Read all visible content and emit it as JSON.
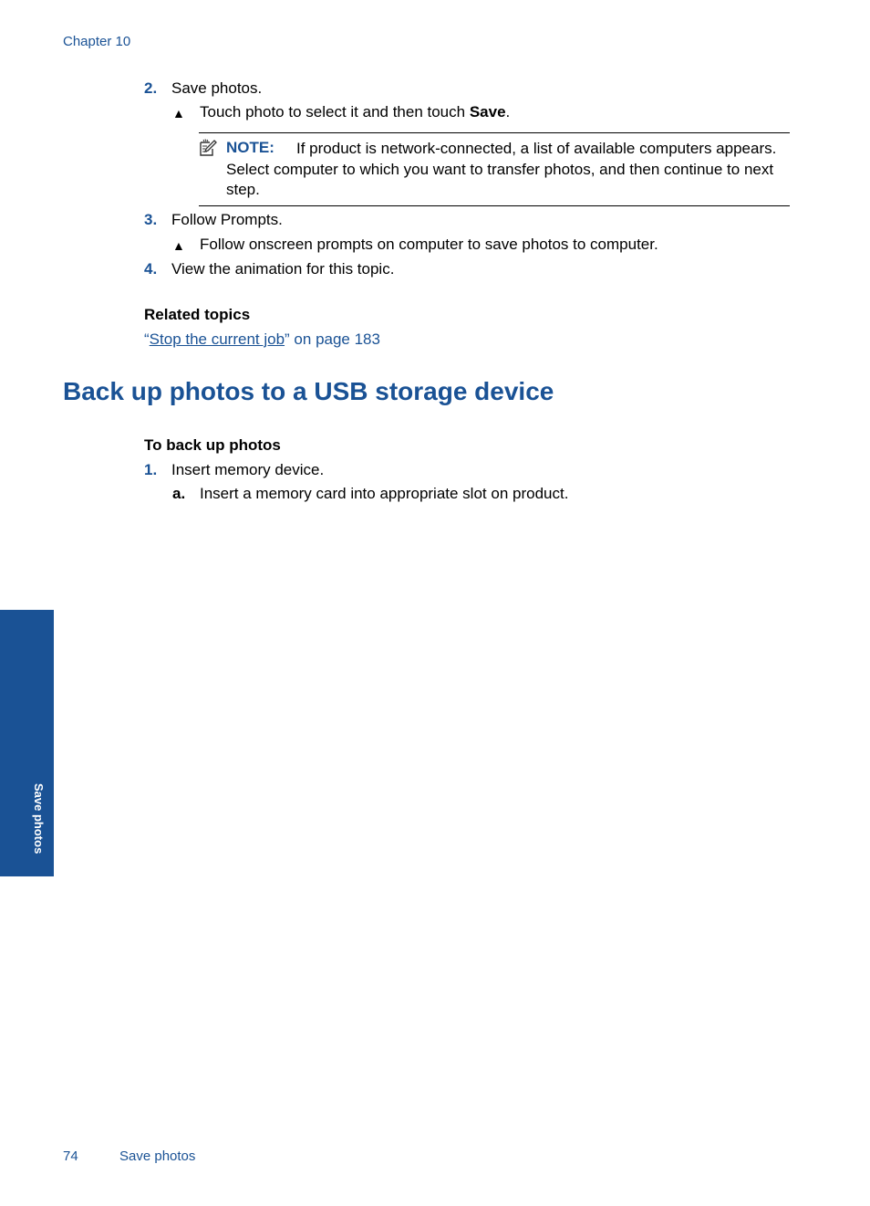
{
  "header": {
    "chapter": "Chapter 10"
  },
  "steps_part1": [
    {
      "number": "2.",
      "text": "Save photos.",
      "bullet": {
        "symbol": "▲",
        "text_before": "Touch photo to select it and then touch ",
        "bold": "Save",
        "text_after": "."
      }
    }
  ],
  "note": {
    "icon": "note-pencil-icon",
    "label": "NOTE:",
    "text": "If product is network-connected, a list of available computers appears. Select computer to which you want to transfer photos, and then continue to next step."
  },
  "steps_part2": [
    {
      "number": "3.",
      "text": "Follow Prompts.",
      "bullet": {
        "symbol": "▲",
        "text": "Follow onscreen prompts on computer to save photos to computer."
      }
    },
    {
      "number": "4.",
      "text": "View the animation for this topic."
    }
  ],
  "related": {
    "heading": "Related topics",
    "link_open_quote": "“",
    "link_text": "Stop the current job",
    "link_suffix": "” on page 183"
  },
  "section": {
    "title": "Back up photos to a USB storage device",
    "procedure_heading": "To back up photos",
    "steps": [
      {
        "number": "1.",
        "text": "Insert memory device.",
        "substeps": [
          {
            "letter": "a.",
            "text": "Insert a memory card into appropriate slot on product."
          }
        ]
      }
    ]
  },
  "side_tab": {
    "label": "Save photos",
    "color": "#1a5295"
  },
  "footer": {
    "page_number": "74",
    "chapter_title": "Save photos"
  },
  "colors": {
    "accent": "#1a5295",
    "text": "#000000",
    "background": "#ffffff"
  }
}
